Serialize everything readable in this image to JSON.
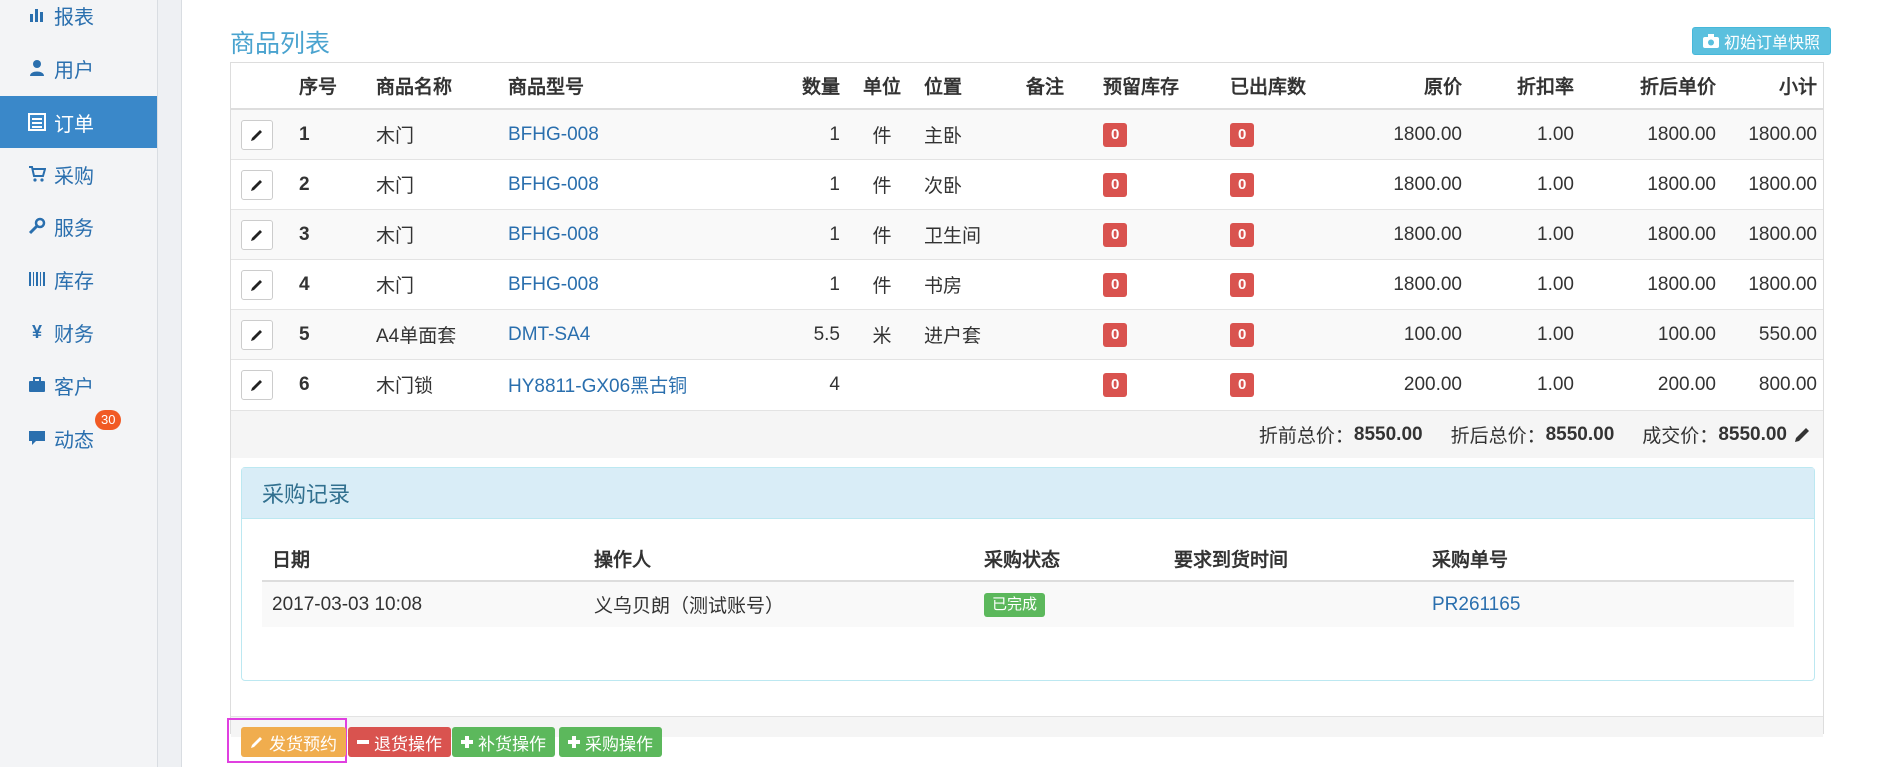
{
  "sidebar": {
    "items": [
      {
        "label": "报表",
        "icon": "bar-chart-icon"
      },
      {
        "label": "用户",
        "icon": "user-icon"
      },
      {
        "label": "订单",
        "icon": "list-icon",
        "active": true
      },
      {
        "label": "采购",
        "icon": "cart-icon"
      },
      {
        "label": "服务",
        "icon": "wrench-icon"
      },
      {
        "label": "库存",
        "icon": "barcode-icon"
      },
      {
        "label": "财务",
        "icon": "yen-icon"
      },
      {
        "label": "客户",
        "icon": "briefcase-icon"
      },
      {
        "label": "动态",
        "icon": "comment-icon",
        "badge": "30"
      }
    ]
  },
  "main": {
    "title": "商品列表",
    "snapshot_button": "初始订单快照"
  },
  "items_table": {
    "headers": [
      "序号",
      "商品名称",
      "商品型号",
      "数量",
      "单位",
      "位置",
      "备注",
      "预留库存",
      "已出库数",
      "原价",
      "折扣率",
      "折后单价",
      "小计"
    ],
    "rows": [
      {
        "no": "1",
        "name": "木门",
        "model": "BFHG-008",
        "qty": "1",
        "unit": "件",
        "location": "主卧",
        "note": "",
        "reserved": "0",
        "shipped": "0",
        "price": "1800.00",
        "discount": "1.00",
        "unit_after": "1800.00",
        "subtotal": "1800.00"
      },
      {
        "no": "2",
        "name": "木门",
        "model": "BFHG-008",
        "qty": "1",
        "unit": "件",
        "location": "次卧",
        "note": "",
        "reserved": "0",
        "shipped": "0",
        "price": "1800.00",
        "discount": "1.00",
        "unit_after": "1800.00",
        "subtotal": "1800.00"
      },
      {
        "no": "3",
        "name": "木门",
        "model": "BFHG-008",
        "qty": "1",
        "unit": "件",
        "location": "卫生间",
        "note": "",
        "reserved": "0",
        "shipped": "0",
        "price": "1800.00",
        "discount": "1.00",
        "unit_after": "1800.00",
        "subtotal": "1800.00"
      },
      {
        "no": "4",
        "name": "木门",
        "model": "BFHG-008",
        "qty": "1",
        "unit": "件",
        "location": "书房",
        "note": "",
        "reserved": "0",
        "shipped": "0",
        "price": "1800.00",
        "discount": "1.00",
        "unit_after": "1800.00",
        "subtotal": "1800.00"
      },
      {
        "no": "5",
        "name": "A4单面套",
        "model": "DMT-SA4",
        "qty": "5.5",
        "unit": "米",
        "location": "进户套",
        "note": "",
        "reserved": "0",
        "shipped": "0",
        "price": "100.00",
        "discount": "1.00",
        "unit_after": "100.00",
        "subtotal": "550.00"
      },
      {
        "no": "6",
        "name": "木门锁",
        "model": "HY8811-GX06黑古铜",
        "qty": "4",
        "unit": "",
        "location": "",
        "note": "",
        "reserved": "0",
        "shipped": "0",
        "price": "200.00",
        "discount": "1.00",
        "unit_after": "200.00",
        "subtotal": "800.00"
      }
    ]
  },
  "totals": {
    "before_label": "折前总价：",
    "before_value": "8550.00",
    "after_label": "折后总价：",
    "after_value": "8550.00",
    "deal_label": "成交价：",
    "deal_value": "8550.00"
  },
  "purchase": {
    "title": "采购记录",
    "headers": [
      "日期",
      "操作人",
      "采购状态",
      "要求到货时间",
      "采购单号"
    ],
    "rows": [
      {
        "date": "2017-03-03 10:08",
        "operator": "义乌贝朗（测试账号）",
        "status": "已完成",
        "arrival": "",
        "order_no": "PR261165"
      }
    ]
  },
  "actions": {
    "ship_booking": "发货预约",
    "return": "退货操作",
    "restock": "补货操作",
    "purchase": "采购操作"
  },
  "colors": {
    "accent": "#3a88c9",
    "danger": "#d9534f",
    "success": "#5cb85c",
    "warning": "#f0ad4e",
    "info": "#5bc0de"
  }
}
